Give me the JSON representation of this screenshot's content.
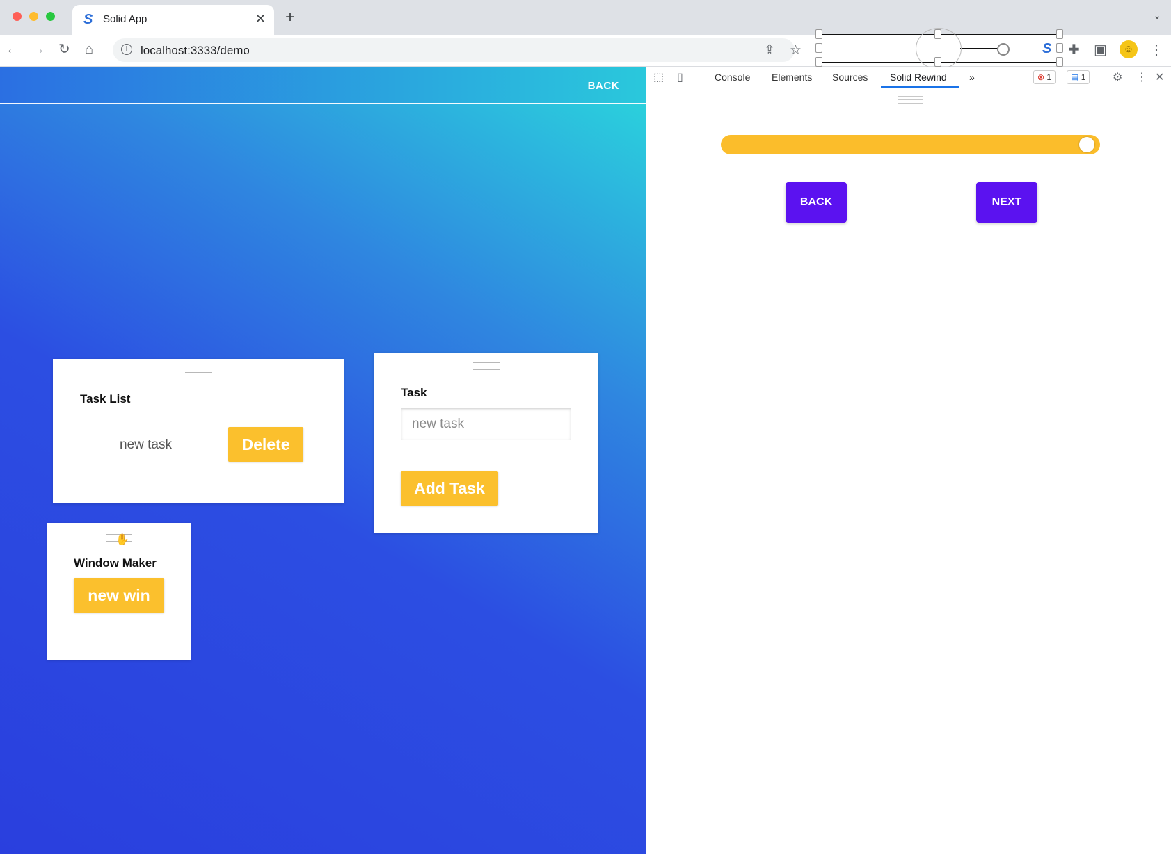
{
  "browser": {
    "tab_title": "Solid App",
    "tab_close": "✕",
    "new_tab": "+",
    "url": "localhost:3333/demo"
  },
  "page": {
    "back_label": "BACK",
    "task_list": {
      "title": "Task List",
      "item_text": "new task",
      "delete_label": "Delete"
    },
    "task_form": {
      "title": "Task",
      "input_placeholder": "new task",
      "add_label": "Add Task"
    },
    "window_maker": {
      "title": "Window Maker",
      "button_label": "new win"
    }
  },
  "devtools": {
    "tabs": [
      "Console",
      "Elements",
      "Sources",
      "Solid Rewind"
    ],
    "active_tab": "Solid Rewind",
    "more_tabs": "»",
    "error_count": "1",
    "message_count": "1",
    "timeline_position": 1.0,
    "back_label": "BACK",
    "next_label": "NEXT",
    "colors": {
      "slider": "#fbbd2b",
      "buttons": "#5b12f0"
    }
  },
  "colors": {
    "accent_yellow": "#fbc02d",
    "gradient_start": "#2ad9dc",
    "gradient_end": "#2a3fde"
  }
}
